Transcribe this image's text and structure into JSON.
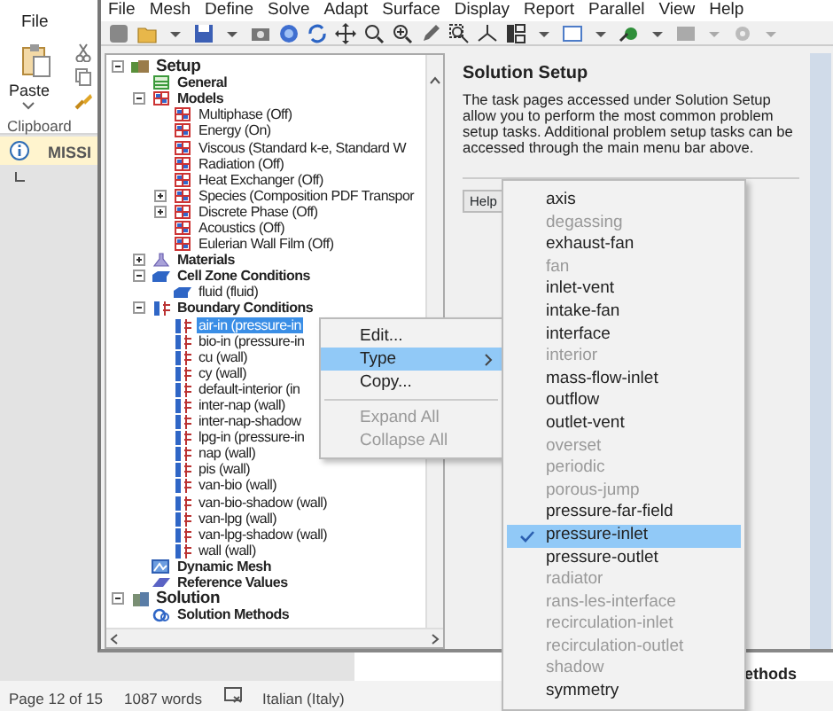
{
  "word": {
    "ribbon_tab": "File",
    "paste_label": "Paste",
    "group_label": "Clipboard",
    "info_bar": "MISSI",
    "document_text": "ethods",
    "status_bar": {
      "page": "Page 12 of 15",
      "words": "1087 words",
      "language": "Italian (Italy)"
    }
  },
  "fluent": {
    "menu": [
      "File",
      "Mesh",
      "Define",
      "Solve",
      "Adapt",
      "Surface",
      "Display",
      "Report",
      "Parallel",
      "View",
      "Help"
    ],
    "tree": [
      {
        "label": "Setup",
        "kind": "setup",
        "expanded": true,
        "selected": false,
        "children": [
          {
            "label": "General",
            "kind": "general",
            "selected": false
          },
          {
            "label": "Models",
            "kind": "models",
            "expanded": true,
            "selected": false,
            "children": [
              {
                "label": "Multiphase (Off)",
                "kind": "model",
                "selected": false
              },
              {
                "label": "Energy (On)",
                "kind": "model",
                "selected": false
              },
              {
                "label": "Viscous (Standard k-e, Standard W",
                "kind": "model",
                "selected": false
              },
              {
                "label": "Radiation (Off)",
                "kind": "model",
                "selected": false
              },
              {
                "label": "Heat Exchanger (Off)",
                "kind": "model",
                "selected": false
              },
              {
                "label": "Species (Composition PDF Transpor",
                "kind": "model",
                "expanded": false,
                "selected": false
              },
              {
                "label": "Discrete Phase (Off)",
                "kind": "model",
                "expanded": false,
                "selected": false
              },
              {
                "label": "Acoustics (Off)",
                "kind": "model",
                "selected": false
              },
              {
                "label": "Eulerian Wall Film (Off)",
                "kind": "model",
                "selected": false
              }
            ]
          },
          {
            "label": "Materials",
            "kind": "materials",
            "expanded": false,
            "selected": false
          },
          {
            "label": "Cell Zone Conditions",
            "kind": "cellzones",
            "expanded": true,
            "selected": false,
            "children": [
              {
                "label": "fluid (fluid)",
                "kind": "zone",
                "selected": false
              }
            ]
          },
          {
            "label": "Boundary Conditions",
            "kind": "boundaries",
            "expanded": true,
            "selected": false,
            "children": [
              {
                "label": "air-in (pressure-in",
                "kind": "boundary",
                "selected": true
              },
              {
                "label": "bio-in (pressure-in",
                "kind": "boundary",
                "selected": false
              },
              {
                "label": "cu (wall)",
                "kind": "boundary",
                "selected": false
              },
              {
                "label": "cy (wall)",
                "kind": "boundary",
                "selected": false
              },
              {
                "label": "default-interior (in",
                "kind": "boundary",
                "selected": false
              },
              {
                "label": "inter-nap (wall)",
                "kind": "boundary",
                "selected": false
              },
              {
                "label": "inter-nap-shadow",
                "kind": "boundary",
                "selected": false
              },
              {
                "label": "lpg-in (pressure-in",
                "kind": "boundary",
                "selected": false
              },
              {
                "label": "nap (wall)",
                "kind": "boundary",
                "selected": false
              },
              {
                "label": "pis (wall)",
                "kind": "boundary",
                "selected": false
              },
              {
                "label": "van-bio (wall)",
                "kind": "boundary",
                "selected": false
              },
              {
                "label": "van-bio-shadow (wall)",
                "kind": "boundary",
                "selected": false
              },
              {
                "label": "van-lpg (wall)",
                "kind": "boundary",
                "selected": false
              },
              {
                "label": "van-lpg-shadow (wall)",
                "kind": "boundary",
                "selected": false
              },
              {
                "label": "wall (wall)",
                "kind": "boundary",
                "selected": false
              }
            ]
          },
          {
            "label": "Dynamic Mesh",
            "kind": "mesh",
            "selected": false
          },
          {
            "label": "Reference Values",
            "kind": "reference",
            "selected": false
          }
        ]
      },
      {
        "label": "Solution",
        "kind": "solution",
        "expanded": true,
        "selected": false,
        "children": [
          {
            "label": "Solution Methods",
            "kind": "methods",
            "selected": false
          }
        ]
      }
    ],
    "task_page": {
      "title": "Solution Setup",
      "description": "The task pages accessed under Solution Setup allow you to perform the most common problem setup tasks. Additional problem setup tasks can be accessed through the main menu bar above.",
      "help_button": "Help"
    },
    "context_menu": [
      {
        "label": "Edit...",
        "kind": "item",
        "disabled": false,
        "selected": false
      },
      {
        "label": "Type",
        "kind": "submenu",
        "disabled": false,
        "selected": true
      },
      {
        "label": "Copy...",
        "kind": "item",
        "disabled": false,
        "selected": false
      },
      {
        "kind": "separator"
      },
      {
        "label": "Expand All",
        "kind": "item",
        "disabled": true,
        "selected": false
      },
      {
        "label": "Collapse All",
        "kind": "item",
        "disabled": true,
        "selected": false
      }
    ],
    "type_menu": [
      {
        "label": "axis",
        "disabled": false,
        "checked": false,
        "selected": false
      },
      {
        "label": "degassing",
        "disabled": true,
        "checked": false,
        "selected": false
      },
      {
        "label": "exhaust-fan",
        "disabled": false,
        "checked": false,
        "selected": false
      },
      {
        "label": "fan",
        "disabled": true,
        "checked": false,
        "selected": false
      },
      {
        "label": "inlet-vent",
        "disabled": false,
        "checked": false,
        "selected": false
      },
      {
        "label": "intake-fan",
        "disabled": false,
        "checked": false,
        "selected": false
      },
      {
        "label": "interface",
        "disabled": false,
        "checked": false,
        "selected": false
      },
      {
        "label": "interior",
        "disabled": true,
        "checked": false,
        "selected": false
      },
      {
        "label": "mass-flow-inlet",
        "disabled": false,
        "checked": false,
        "selected": false
      },
      {
        "label": "outflow",
        "disabled": false,
        "checked": false,
        "selected": false
      },
      {
        "label": "outlet-vent",
        "disabled": false,
        "checked": false,
        "selected": false
      },
      {
        "label": "overset",
        "disabled": true,
        "checked": false,
        "selected": false
      },
      {
        "label": "periodic",
        "disabled": true,
        "checked": false,
        "selected": false
      },
      {
        "label": "porous-jump",
        "disabled": true,
        "checked": false,
        "selected": false
      },
      {
        "label": "pressure-far-field",
        "disabled": false,
        "checked": false,
        "selected": false
      },
      {
        "label": "pressure-inlet",
        "disabled": false,
        "checked": true,
        "selected": true
      },
      {
        "label": "pressure-outlet",
        "disabled": false,
        "checked": false,
        "selected": false
      },
      {
        "label": "radiator",
        "disabled": true,
        "checked": false,
        "selected": false
      },
      {
        "label": "rans-les-interface",
        "disabled": true,
        "checked": false,
        "selected": false
      },
      {
        "label": "recirculation-inlet",
        "disabled": true,
        "checked": false,
        "selected": false
      },
      {
        "label": "recirculation-outlet",
        "disabled": true,
        "checked": false,
        "selected": false
      },
      {
        "label": "shadow",
        "disabled": true,
        "checked": false,
        "selected": false
      },
      {
        "label": "symmetry",
        "disabled": false,
        "checked": false,
        "selected": false
      }
    ]
  }
}
